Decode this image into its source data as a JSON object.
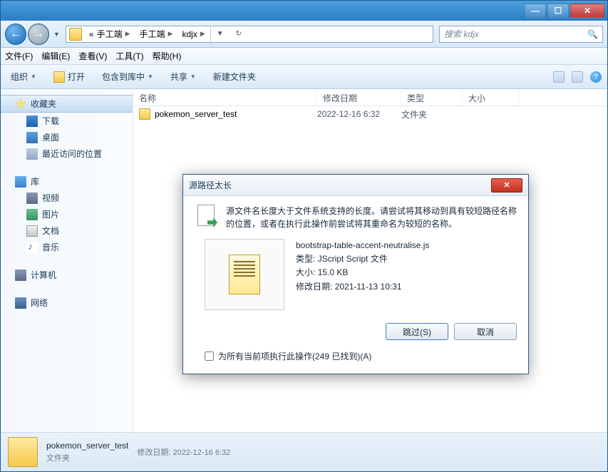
{
  "breadcrumb": {
    "root_prefix": "«",
    "items": [
      "手工端",
      "手工端",
      "kdjx"
    ]
  },
  "search": {
    "placeholder": "搜索 kdjx"
  },
  "menus": {
    "file": "文件(F)",
    "edit": "编辑(E)",
    "view": "查看(V)",
    "tools": "工具(T)",
    "help": "帮助(H)"
  },
  "toolbar": {
    "organize": "组织",
    "open": "打开",
    "include": "包含到库中",
    "share": "共享",
    "newfolder": "新建文件夹"
  },
  "sidebar": {
    "favorites": {
      "label": "收藏夹",
      "items": [
        {
          "label": "下载"
        },
        {
          "label": "桌面"
        },
        {
          "label": "最近访问的位置"
        }
      ]
    },
    "libraries": {
      "label": "库",
      "items": [
        {
          "label": "视频"
        },
        {
          "label": "图片"
        },
        {
          "label": "文档"
        },
        {
          "label": "音乐"
        }
      ]
    },
    "computer": {
      "label": "计算机"
    },
    "network": {
      "label": "网络"
    }
  },
  "columns": {
    "name": "名称",
    "date": "修改日期",
    "type": "类型",
    "size": "大小"
  },
  "files": [
    {
      "name": "pokemon_server_test",
      "date": "2022-12-16 6:32",
      "type": "文件夹"
    }
  ],
  "statusbar": {
    "name": "pokemon_server_test",
    "type": "文件夹",
    "date_label": "修改日期:",
    "date": "2022-12-16 6:32"
  },
  "dialog": {
    "title": "源路径太长",
    "message": "源文件名长度大于文件系统支持的长度。请尝试将其移动到具有较短路径名称的位置，或者在执行此操作前尝试将其重命名为较短的名称。",
    "file": {
      "name": "bootstrap-table-accent-neutralise.js",
      "type_label": "类型:",
      "type": "JScript Script 文件",
      "size_label": "大小:",
      "size": "15.0 KB",
      "date_label": "修改日期:",
      "date": "2021-11-13 10:31"
    },
    "skip": "跳过(S)",
    "cancel": "取消",
    "checkbox": "为所有当前项执行此操作(249 已找到)(A)"
  }
}
